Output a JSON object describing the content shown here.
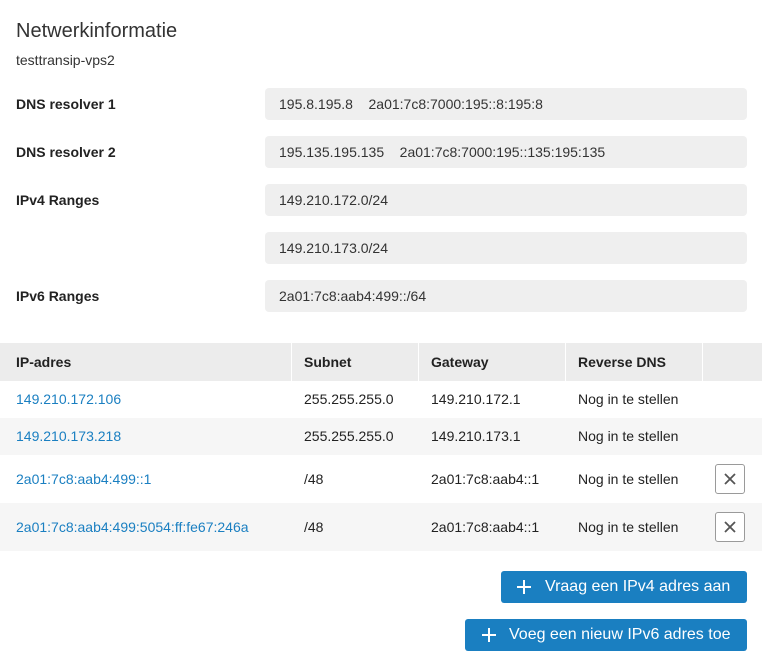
{
  "header": {
    "title": "Netwerkinformatie",
    "subtitle": "testtransip-vps2"
  },
  "info": {
    "dns1_label": "DNS resolver 1",
    "dns1_value": "195.8.195.8    2a01:7c8:7000:195::8:195:8",
    "dns2_label": "DNS resolver 2",
    "dns2_value": "195.135.195.135    2a01:7c8:7000:195::135:195:135",
    "ipv4_label": "IPv4 Ranges",
    "ipv4_range_1": "149.210.172.0/24",
    "ipv4_range_2": "149.210.173.0/24",
    "ipv6_label": "IPv6 Ranges",
    "ipv6_range_1": "2a01:7c8:aab4:499::/64"
  },
  "table": {
    "headers": {
      "ip": "IP-adres",
      "subnet": "Subnet",
      "gateway": "Gateway",
      "rdns": "Reverse DNS"
    },
    "rows": [
      {
        "ip": "149.210.172.106",
        "subnet": "255.255.255.0",
        "gateway": "149.210.172.1",
        "rdns": "Nog in te stellen"
      },
      {
        "ip": "149.210.173.218",
        "subnet": "255.255.255.0",
        "gateway": "149.210.173.1",
        "rdns": "Nog in te stellen"
      },
      {
        "ip": "2a01:7c8:aab4:499::1",
        "subnet": "/48",
        "gateway": "2a01:7c8:aab4::1",
        "rdns": "Nog in te stellen"
      },
      {
        "ip": "2a01:7c8:aab4:499:5054:ff:fe67:246a",
        "subnet": "/48",
        "gateway": "2a01:7c8:aab4::1",
        "rdns": "Nog in te stellen"
      }
    ]
  },
  "actions": {
    "request_ipv4": "Vraag een IPv4 adres aan",
    "add_ipv6": "Voeg een nieuw IPv6 adres toe"
  },
  "colors": {
    "accent": "#1a7fc1",
    "field_bg": "#efefef",
    "header_bg": "#ececec"
  }
}
